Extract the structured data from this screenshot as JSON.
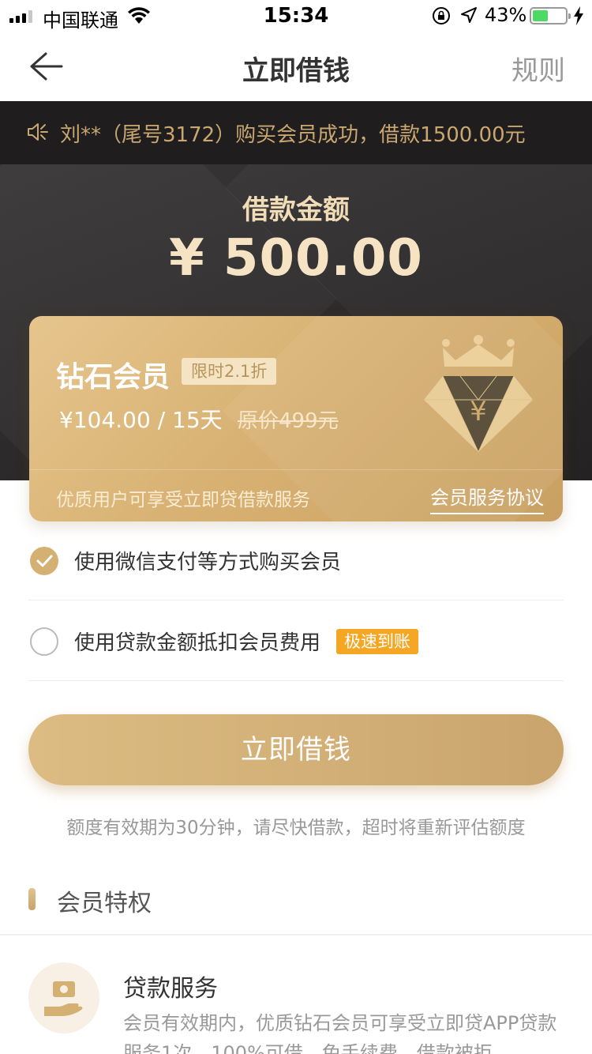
{
  "status_bar": {
    "carrier": "中国联通",
    "time": "15:34",
    "battery_percent": "43%",
    "signal_bars_active": 3,
    "signal_bars_total": 4,
    "battery_level": 0.43
  },
  "nav": {
    "title": "立即借钱",
    "rules_label": "规则"
  },
  "notice": {
    "text": "刘**（尾号3172）购买会员成功，借款1500.00元"
  },
  "loan": {
    "label": "借款金额",
    "amount": "¥ 500.00"
  },
  "membership_card": {
    "title": "钻石会员",
    "tag": "限时2.1折",
    "price": "¥104.00  /  15天",
    "original_price": "原价499元",
    "footer_text": "优质用户可享受立即贷借款服务",
    "agreement_link": "会员服务协议",
    "emblem_symbol": "¥"
  },
  "options": [
    {
      "label": "使用微信支付等方式购买会员",
      "checked": true
    },
    {
      "label": "使用贷款金额抵扣会员费用",
      "checked": false,
      "tag": "极速到账"
    }
  ],
  "cta": {
    "label": "立即借钱"
  },
  "hint": "额度有效期为30分钟，请尽快借款，超时将重新评估额度",
  "privileges": {
    "section_title": "会员特权",
    "items": [
      {
        "title": "贷款服务",
        "description": "会员有效期内，优质钻石会员可享受立即贷APP贷款服务1次，100%可借，免手续费，借款被拒",
        "icon": "hand-money-icon"
      }
    ]
  },
  "colors": {
    "gold": "#d4b173",
    "dark_bg": "#2c2a2a",
    "orange_tag": "#f5a623"
  }
}
